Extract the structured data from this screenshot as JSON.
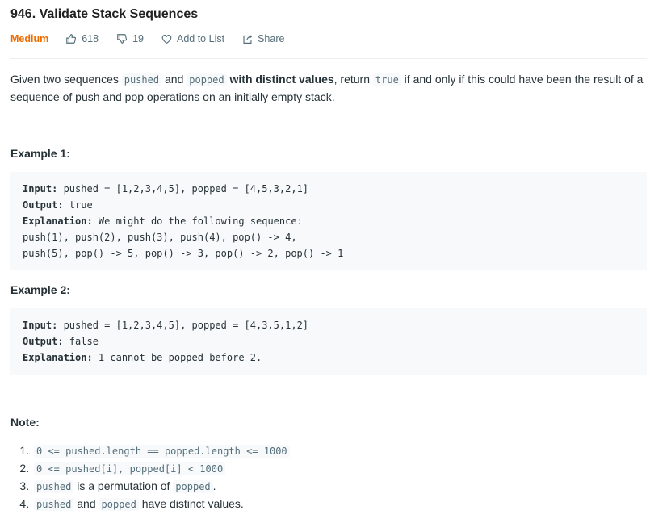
{
  "problem": {
    "title": "946. Validate Stack Sequences",
    "difficulty": "Medium",
    "likes": "618",
    "dislikes": "19",
    "add_to_list": "Add to List",
    "share": "Share"
  },
  "description": {
    "p1": "Given two sequences ",
    "code_pushed": "pushed",
    "p2": " and ",
    "code_popped": "popped",
    "p3": " ",
    "bold": "with distinct values",
    "p4": ", return ",
    "code_true": "true",
    "p5": " if and only if this could have been the result of a sequence of push and pop operations on an initially empty stack."
  },
  "examples": [
    {
      "title": "Example 1:",
      "input_label": "Input:",
      "input": " pushed = [1,2,3,4,5], popped = [4,5,3,2,1]",
      "output_label": "Output:",
      "output": " true",
      "explanation_label": "Explanation:",
      "explanation": " We might do the following sequence:",
      "extra_lines": [
        "push(1), push(2), push(3), push(4), pop() -> 4,",
        "push(5), pop() -> 5, pop() -> 3, pop() -> 2, pop() -> 1"
      ]
    },
    {
      "title": "Example 2:",
      "input_label": "Input:",
      "input": " pushed = [1,2,3,4,5], popped = [4,3,5,1,2]",
      "output_label": "Output:",
      "output": " false",
      "explanation_label": "Explanation:",
      "explanation": " 1 cannot be popped before 2."
    }
  ],
  "note": {
    "title": "Note:",
    "items": [
      {
        "code": "0 <= pushed.length == popped.length <= 1000"
      },
      {
        "code": "0 <= pushed[i], popped[i] < 1000"
      },
      {
        "code": "pushed",
        "text": " is a permutation of ",
        "code2": "popped",
        "text2": "."
      },
      {
        "code": "pushed",
        "text": " and ",
        "code2": "popped",
        "text2": " have distinct values."
      }
    ]
  },
  "colors": {
    "difficulty": "#ef6c00",
    "meta": "#546e7a",
    "code_bg": "#f7f9fa"
  },
  "icons": [
    "thumbs-up-icon",
    "thumbs-down-icon",
    "heart-icon",
    "share-icon"
  ]
}
